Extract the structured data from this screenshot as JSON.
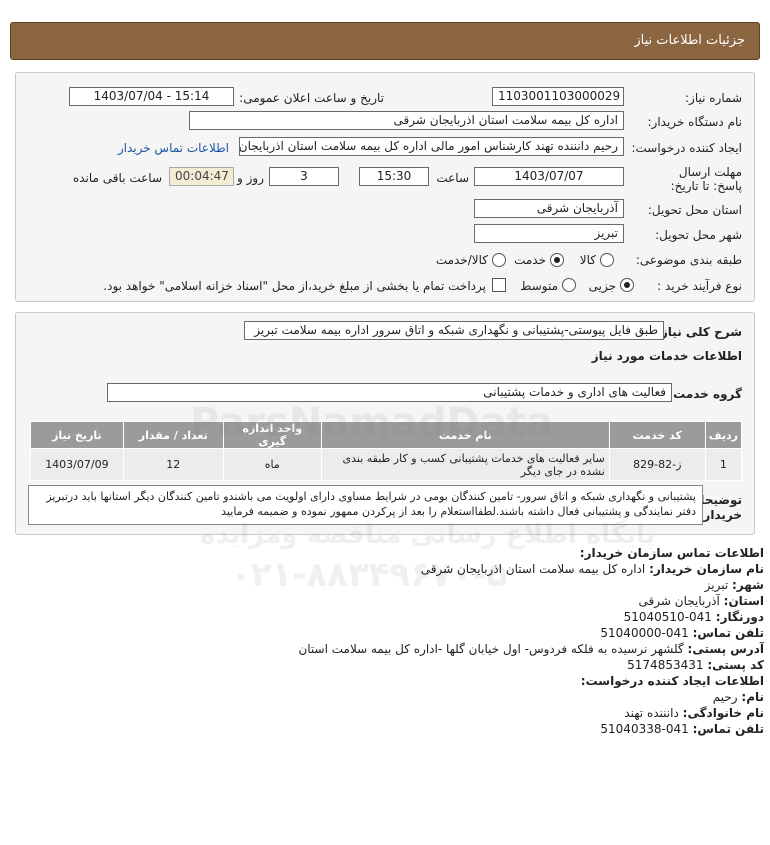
{
  "header": {
    "title": "جزئیات اطلاعات نیاز"
  },
  "form": {
    "need_number": {
      "label": "شماره نیاز:",
      "value": "1103001103000029"
    },
    "announce": {
      "label": "تاریخ و ساعت اعلان عمومی:",
      "value": "1403/07/04 - 15:14"
    },
    "buyer_org": {
      "label": "نام دستگاه خریدار:",
      "value": "اداره کل بیمه سلامت استان اذربایجان شرقی"
    },
    "creator": {
      "label": "ایجاد کننده درخواست:",
      "value": "رحیم  دانننده تهند کارشناس امور مالی اداره کل بیمه سلامت استان اذربایجان شرقی",
      "contact_link": "اطلاعات تماس خریدار"
    },
    "deadline": {
      "label": "مهلت ارسال پاسخ: تا تاریخ:",
      "date": "1403/07/07",
      "time_label": "ساعت",
      "time": "15:30",
      "days": "3",
      "days_label": "روز و",
      "remaining": "00:04:47",
      "remaining_label": "ساعت باقی مانده"
    },
    "province": {
      "label": "استان محل تحویل:",
      "value": "آذربایجان شرقی"
    },
    "city": {
      "label": "شهر محل تحویل:",
      "value": "تبریز"
    },
    "category": {
      "label": "طبقه بندی موضوعی:",
      "options": [
        "کالا",
        "خدمت",
        "کالا/خدمت"
      ],
      "selected": "خدمت"
    },
    "process": {
      "label": "نوع فرآیند خرید :",
      "options": [
        "جزیی",
        "متوسط"
      ],
      "selected": "جزیی",
      "treasury_text": "پرداخت تمام یا بخشی از مبلغ خرید،از محل \"اسناد خزانه اسلامی\" خواهد بود."
    }
  },
  "need": {
    "summary_label": "شرح کلی نیاز:",
    "summary": "طبق فایل پیوستی-پشتیبانی و نگهداری شبکه و اتاق سرور اداره بیمه سلامت تبریز",
    "services_title": "اطلاعات خدمات مورد نیاز",
    "group_label": "گروه خدمت:",
    "group_value": "فعالیت های اداری و خدمات پشتیبانی",
    "table": {
      "headers": [
        "ردیف",
        "کد خدمت",
        "نام خدمت",
        "واحد اندازه گیری",
        "تعداد / مقدار",
        "تاریخ نیاز"
      ],
      "rows": [
        {
          "row": "1",
          "code": "ز-82-829",
          "name": "سایر فعالیت های خدمات پشتیبانی کسب و کار طبقه بندی نشده در جای دیگر",
          "unit": "ماه",
          "qty": "12",
          "date": "1403/07/09"
        }
      ]
    },
    "buyer_desc_label": "توضیحات خریدار:",
    "buyer_desc": "پشتیبانی و نگهداری شبکه و اتاق سرور- تامین کنندگان بومی در شرایط مساوی دارای اولویت می باشندو تامین کنندگان دیگر استانها باید درتبریز دفتر نمایندگی و پشتیبانی فعال داشته باشند.لطفااستعلام را بعد از پرکردن ممهور نموده و ضمیمه فرمایید"
  },
  "contact": {
    "org_title": "اطلاعات تماس سازمان خریدار:",
    "org_name_label": "نام سازمان خریدار:",
    "org_name": "اداره کل بیمه سلامت استان اذربایجان شرقی",
    "city_label": "شهر:",
    "city": "تبریز",
    "province_label": "استان:",
    "province": "آذربایجان شرقی",
    "fax_label": "دورنگار:",
    "fax": "041-51040510",
    "phone_label": "تلفن تماس:",
    "phone": "041-51040000",
    "address_label": "آدرس پستی:",
    "address": "گلشهر نرسیده به فلکه فردوس- اول خیابان گلها -اداره کل بیمه سلامت استان",
    "postal_label": "کد پستی:",
    "postal": "5174853431",
    "creator_title": "اطلاعات ایجاد کننده درخواست:",
    "name_label": "نام:",
    "name": "رحیم",
    "family_label": "نام خانوادگی:",
    "family": "دانننده تهند",
    "creator_phone_label": "تلفن تماس:",
    "creator_phone": "041-51040338"
  },
  "watermark": {
    "line1": "پایگاه اطلاع رسانی مناقصه ومزایده",
    "line2": "۰۲۱-۸۸۳۴۹۶۷۰-۵",
    "brand": "ParsNamadData"
  }
}
